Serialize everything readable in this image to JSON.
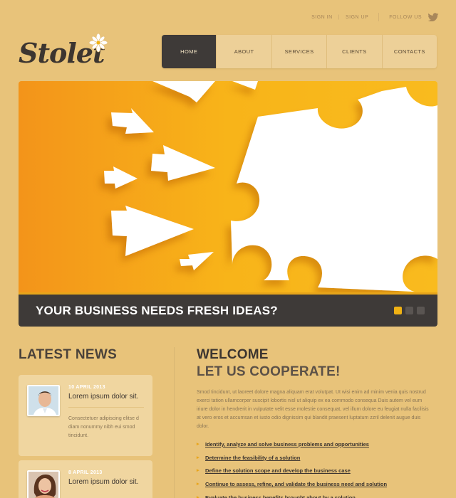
{
  "header": {
    "logo_text": "Stolet",
    "sign_in": "SIGN IN",
    "separator": "|",
    "sign_up": "SIGN UP",
    "follow_us": "FOLLOW US"
  },
  "nav": {
    "items": [
      {
        "label": "HOME",
        "active": true
      },
      {
        "label": "ABOUT",
        "active": false
      },
      {
        "label": "SERVICES",
        "active": false
      },
      {
        "label": "CLIENTS",
        "active": false
      },
      {
        "label": "CONTACTS",
        "active": false
      }
    ]
  },
  "hero": {
    "caption": "YOUR BUSINESS NEEDS FRESH IDEAS?",
    "slides_count": 3,
    "active_slide": 1
  },
  "news": {
    "title": "LATEST NEWS",
    "items": [
      {
        "date": "10 APRIL 2013",
        "title": "Lorem ipsum dolor sit.",
        "text": "Consectetuer adipiscing elitse d diam nonummy nibh eui smod tincidunt."
      },
      {
        "date": "8 APRIL 2013",
        "title": "Lorem ipsum dolor sit.",
        "text": ""
      }
    ]
  },
  "welcome": {
    "title": "WELCOME",
    "subtitle": "LET US COOPERATE!",
    "text": "Smod tincidunt, ut laoreet dolore magna aliquam erat volutpat. Ut wisi enim ad minim venia quis nostrud exerci tation ullamcorper suscipit lobortis nisl ut aliquip ex ea commodo consequa Duis autem vel eum iriure dolor in hendrerit in vulputate velit esse molestie consequat, vel illum dolore eu feugiat nulla facilisis at vero eros et accumsan et iusto odio dignissim qui blandit praesent luptatum zzril delenit augue duis dolor.",
    "bullets": [
      "Identify, analyze and solve business problems and opportunities",
      "Determine the feasibility of a solution",
      "Define the solution scope and develop the business case",
      "Continue to assess, refine, and validate the business need and solution",
      "Evaluate the business benefits brought about by a solution"
    ]
  },
  "colors": {
    "background": "#e8c37a",
    "dark": "#3e3a38",
    "accent": "#f0b214",
    "hero_orange": "#f5a813"
  },
  "icons": [
    "twitter-bird-icon",
    "logo-star-icon"
  ]
}
